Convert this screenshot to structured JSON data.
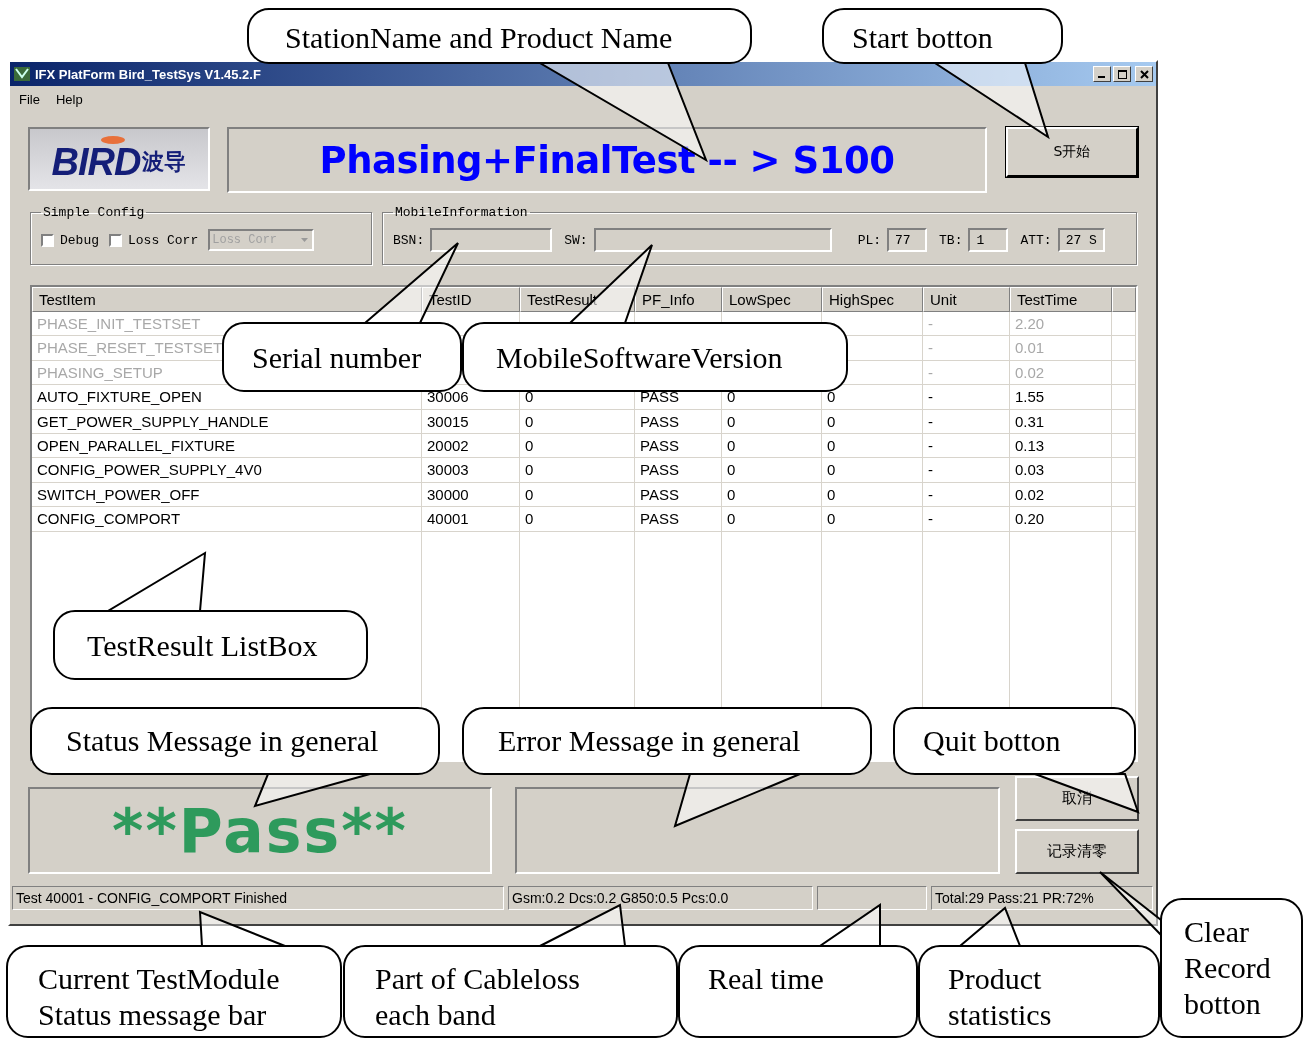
{
  "window": {
    "title": "IFX PlatForm Bird_TestSys V1.45.2.F"
  },
  "menu": [
    "File",
    "Help"
  ],
  "logo": {
    "brand": "BIRD",
    "brand_cn": "波导"
  },
  "banner": "Phasing+FinalTest -- > S100",
  "start_button": "S开始",
  "simple_config": {
    "title": "Simple Config",
    "options": [
      {
        "label": "Debug",
        "checked": false
      },
      {
        "label": "Loss Corr",
        "checked": false
      }
    ],
    "dropdown": {
      "value": "Loss Corr",
      "disabled": true
    }
  },
  "mobile_information": {
    "title": "MobileInformation",
    "fields": [
      {
        "label": "BSN:"
      },
      {
        "label": "SW:"
      },
      {
        "label": "PL:",
        "value": "77"
      },
      {
        "label": "TB:",
        "value": "1"
      },
      {
        "label": "ATT:",
        "value": "27 S"
      }
    ]
  },
  "table": {
    "columns": [
      "TestItem",
      "TestID",
      "TestResult",
      "PF_Info",
      "LowSpec",
      "HighSpec",
      "Unit",
      "TestTime"
    ],
    "rows": [
      {
        "cells": [
          "PHASE_INIT_TESTSET",
          null,
          null,
          null,
          null,
          null,
          "-",
          "2.20"
        ],
        "disabled": true
      },
      {
        "cells": [
          "PHASE_RESET_TESTSET",
          null,
          null,
          null,
          null,
          null,
          "-",
          "0.01"
        ],
        "disabled": true
      },
      {
        "cells": [
          "PHASING_SETUP",
          null,
          null,
          null,
          null,
          null,
          "-",
          "0.02"
        ],
        "disabled": true
      },
      {
        "cells": [
          "AUTO_FIXTURE_OPEN",
          "30006",
          "0",
          "PASS",
          "0",
          "0",
          "-",
          "1.55"
        ],
        "disabled": false
      },
      {
        "cells": [
          "GET_POWER_SUPPLY_HANDLE",
          "30015",
          "0",
          "PASS",
          "0",
          "0",
          "-",
          "0.31"
        ],
        "disabled": false
      },
      {
        "cells": [
          "OPEN_PARALLEL_FIXTURE",
          "20002",
          "0",
          "PASS",
          "0",
          "0",
          "-",
          "0.13"
        ],
        "disabled": false
      },
      {
        "cells": [
          "CONFIG_POWER_SUPPLY_4V0",
          "30003",
          "0",
          "PASS",
          "0",
          "0",
          "-",
          "0.03"
        ],
        "disabled": false
      },
      {
        "cells": [
          "SWITCH_POWER_OFF",
          "30000",
          "0",
          "PASS",
          "0",
          "0",
          "-",
          "0.02"
        ],
        "disabled": false
      },
      {
        "cells": [
          "CONFIG_COMPORT",
          "40001",
          "0",
          "PASS",
          "0",
          "0",
          "-",
          "0.20"
        ],
        "disabled": false
      }
    ]
  },
  "result": "**Pass**",
  "buttons": [
    "取消",
    "记录清零"
  ],
  "status_bar": {
    "message": "Test 40001 - CONFIG_COMPORT  Finished",
    "cableloss": "Gsm:0.2  Dcs:0.2  G850:0.5  Pcs:0.0",
    "statistics": "Total:29  Pass:21  PR:72%"
  },
  "callouts": [
    {
      "text": "StationName and Product Name"
    },
    {
      "text": "Start botton"
    },
    {
      "text": "Serial number"
    },
    {
      "text": "MobileSoftwareVersion"
    },
    {
      "text": "TestResult ListBox"
    },
    {
      "text": "Status Message in general"
    },
    {
      "text": "Error Message in general"
    },
    {
      "text": "Quit botton"
    },
    {
      "text": "Current TestModule Status message bar"
    },
    {
      "text": "Part of Cableloss each band"
    },
    {
      "text": "Real time"
    },
    {
      "text": "Product statistics"
    },
    {
      "text": "Clear Record botton"
    }
  ]
}
